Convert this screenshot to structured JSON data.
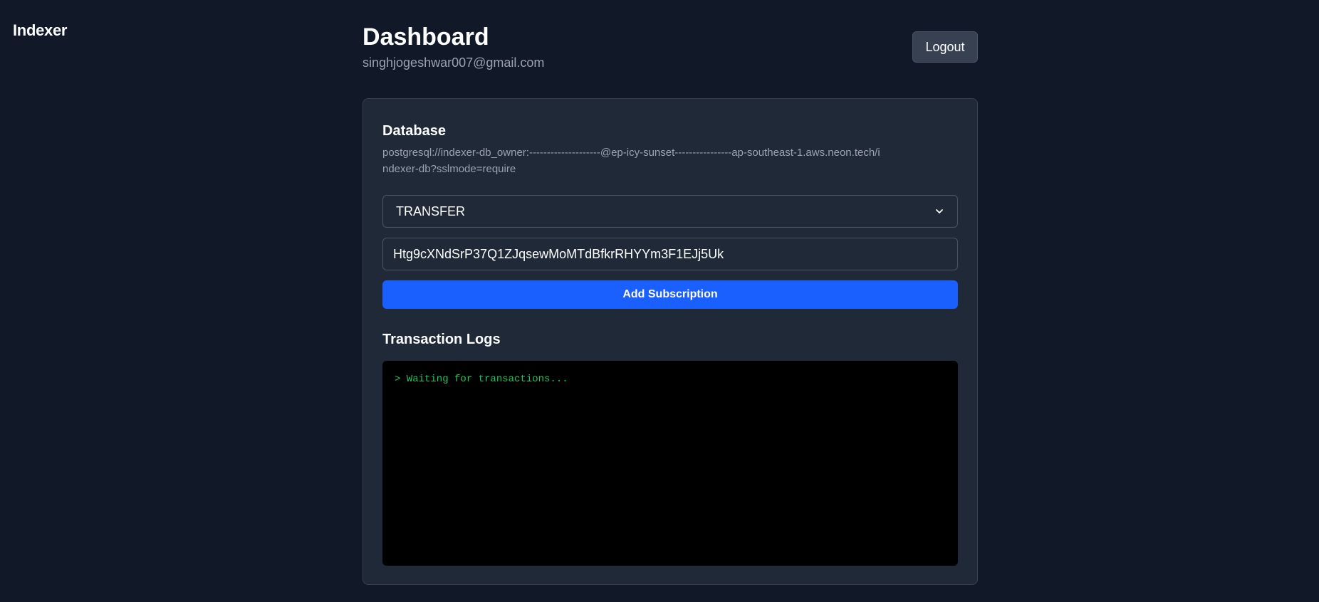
{
  "app": {
    "brand": "Indexer"
  },
  "header": {
    "title": "Dashboard",
    "email": "singhjogeshwar007@gmail.com",
    "logout_label": "Logout"
  },
  "database": {
    "title": "Database",
    "url": "postgresql://indexer-db_owner:--------------------@ep-icy-sunset----------------ap-southeast-1.aws.neon.tech/indexer-db?sslmode=require"
  },
  "subscription": {
    "event_type": "TRANSFER",
    "address_value": "Htg9cXNdSrP37Q1ZJqsewMoMTdBfkrRHYYm3F1EJj5Uk",
    "add_label": "Add Subscription"
  },
  "logs": {
    "title": "Transaction Logs",
    "lines": [
      "> Waiting for transactions..."
    ]
  },
  "icons": {
    "select_chevron": "chevron-down-icon"
  },
  "colors": {
    "background": "#111827",
    "card": "#1f2937",
    "accent": "#1a5fff",
    "log_text": "#22c55e"
  }
}
